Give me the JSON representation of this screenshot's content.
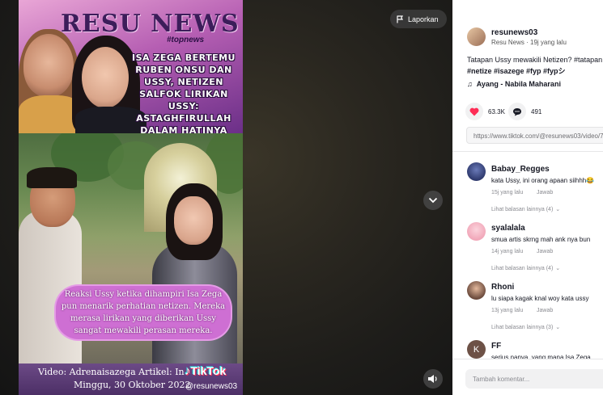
{
  "video": {
    "brand": "RESU NEWS",
    "hashtag": "#topnews",
    "headline_lines": [
      "ISA ZEGA BERTEMU",
      "RUBEN ONSU DAN",
      "USSY, NETIZEN",
      "SALFOK LIRIKAN USSY:",
      "ASTAGHFIRULLAH",
      "DALAM HATINYA"
    ],
    "caption": "Reaksi Ussy ketika dihampiri Isa Zega pun menarik perhatian netizen. Mereka merasa lirikan yang diberikan Ussy sangat mewakili perasan mereka.",
    "credit_line1": "Video: Adrenaisazega   Artikel: In",
    "credit_line2": "Minggu, 30 Oktober 2022",
    "watermark_logo": "TikTok",
    "watermark_user": "@resunews03",
    "report_label": "Laporkan",
    "icons": {
      "report": "flag-icon",
      "next": "chevron-down-icon",
      "volume": "speaker-icon"
    }
  },
  "panel": {
    "author": {
      "username": "resunews03",
      "meta": "Resu News · 19j yang lalu"
    },
    "description_line1": "Tatapan Ussy mewakili Netizen? #tatapan",
    "description_line2": "#netize #isazege #fyp #fypシ",
    "music": "Ayang - Nabila Maharani",
    "likes": "63.3K",
    "comments_count": "491",
    "link": "https://www.tiktok.com/@resunews03/video/7",
    "comments": [
      {
        "username": "Babay_Regges",
        "text": "kata Ussy, ini orang apaan siihhh😂",
        "time": "15j yang lalu",
        "reply": "Jawab",
        "more": "Lihat balasan lainnya (4)"
      },
      {
        "username": "syalalala",
        "text": "smua artis skrng mah ank nya bun",
        "time": "14j yang lalu",
        "reply": "Jawab",
        "more": "Lihat balasan lainnya (4)"
      },
      {
        "username": "Rhoni",
        "text": "lu siapa kagak knal woy kata ussy",
        "time": "13j yang lalu",
        "reply": "Jawab",
        "more": "Lihat balasan lainnya (3)"
      },
      {
        "username": "FF",
        "text": "serius nanya, yang mana Isa Zega",
        "avatar_letter": "K"
      }
    ],
    "comment_input_placeholder": "Tambah komentar..."
  },
  "colors": {
    "accent": "#fe2c55",
    "caption_bg": "#ce6fd3"
  }
}
